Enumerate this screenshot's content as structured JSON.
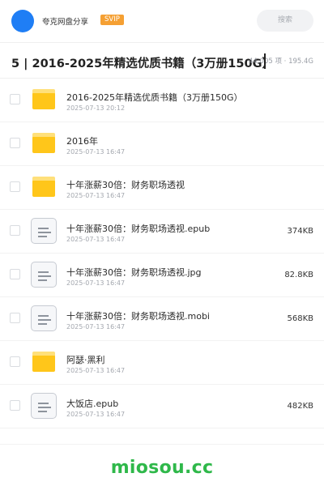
{
  "header": {
    "brand": "夸克网盘分享",
    "badge": "SVIP",
    "search_placeholder": "搜索"
  },
  "folder": {
    "title": "5 | 2016-2025年精选优质书籍（3万册150G）",
    "meta": "44,005 项 · 195.4G"
  },
  "items": [
    {
      "type": "folder",
      "name": "2016-2025年精选优质书籍（3万册150G）",
      "date": "2025-07-13 20:12",
      "size": ""
    },
    {
      "type": "folder",
      "name": "2016年",
      "date": "2025-07-13 16:47",
      "size": ""
    },
    {
      "type": "folder",
      "name": "十年涨薪30倍：财务职场透视",
      "date": "2025-07-13 16:47",
      "size": ""
    },
    {
      "type": "file",
      "name": "十年涨薪30倍：财务职场透视.epub",
      "date": "2025-07-13 16:47",
      "size": "374KB"
    },
    {
      "type": "file",
      "name": "十年涨薪30倍：财务职场透视.jpg",
      "date": "2025-07-13 16:47",
      "size": "82.8KB"
    },
    {
      "type": "file",
      "name": "十年涨薪30倍：财务职场透视.mobi",
      "date": "2025-07-13 16:47",
      "size": "568KB"
    },
    {
      "type": "folder",
      "name": "阿瑟·黑利",
      "date": "2025-07-13 16:47",
      "size": ""
    },
    {
      "type": "file",
      "name": "大饭店.epub",
      "date": "2025-07-13 16:47",
      "size": "482KB"
    }
  ],
  "footer": {
    "watermark": "miosou.cc"
  },
  "colors": {
    "accent": "#1f7ef5",
    "badge": "#f5a033",
    "folder": "#ffc61a",
    "watermark": "#2fb84a"
  },
  "icons": {
    "folder": "folder-icon",
    "file": "document-icon"
  }
}
